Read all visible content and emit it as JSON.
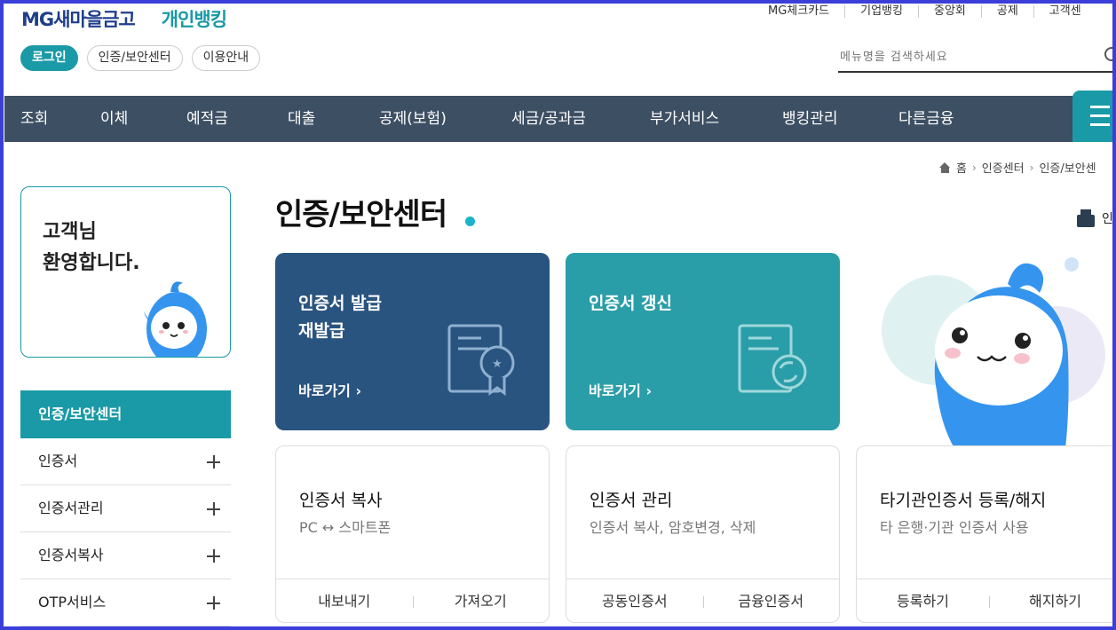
{
  "header": {
    "logo_main": "MG새마을금고",
    "logo_sub": "개인뱅킹",
    "util_links": [
      "MG체크카드",
      "기업뱅킹",
      "중앙회",
      "공제",
      "고객센"
    ],
    "pills": [
      "로그인",
      "인증/보안센터",
      "이용안내"
    ],
    "search_placeholder": "메뉴명을 검색하세요"
  },
  "gnb": [
    "조회",
    "이체",
    "예적금",
    "대출",
    "공제(보험)",
    "세금/공과금",
    "부가서비스",
    "뱅킹관리",
    "다른금융"
  ],
  "breadcrumb": [
    "홈",
    "인증센터",
    "인증/보안센"
  ],
  "sidebar": {
    "welcome_line1": "고객님",
    "welcome_line2": "환영합니다.",
    "nav_head": "인증/보안센터",
    "nav_items": [
      "인증서",
      "인증서관리",
      "인증서복사",
      "OTP서비스"
    ]
  },
  "main": {
    "title": "인증/보안센터",
    "print_label": "인",
    "big_cards": [
      {
        "line1": "인증서 발급",
        "line2": "재발급",
        "go": "바로가기 ›"
      },
      {
        "line1": "인증서 갱신",
        "line2": "",
        "go": "바로가기 ›"
      }
    ],
    "cards": [
      {
        "title": "인증서 복사",
        "sub": "PC ↔ 스마트폰",
        "links": [
          "내보내기",
          "가져오기"
        ]
      },
      {
        "title": "인증서 관리",
        "sub": "인증서 복사, 암호변경, 삭제",
        "links": [
          "공동인증서",
          "금융인증서"
        ]
      },
      {
        "title": "타기관인증서 등록/해지",
        "sub": "타 은행·기관 인증서 사용",
        "links": [
          "등록하기",
          "해지하기"
        ]
      }
    ]
  },
  "colors": {
    "accent": "#1a9aa6",
    "navy": "#2a5480",
    "gnb": "#3d4f63",
    "frame": "#3b3fd8"
  }
}
